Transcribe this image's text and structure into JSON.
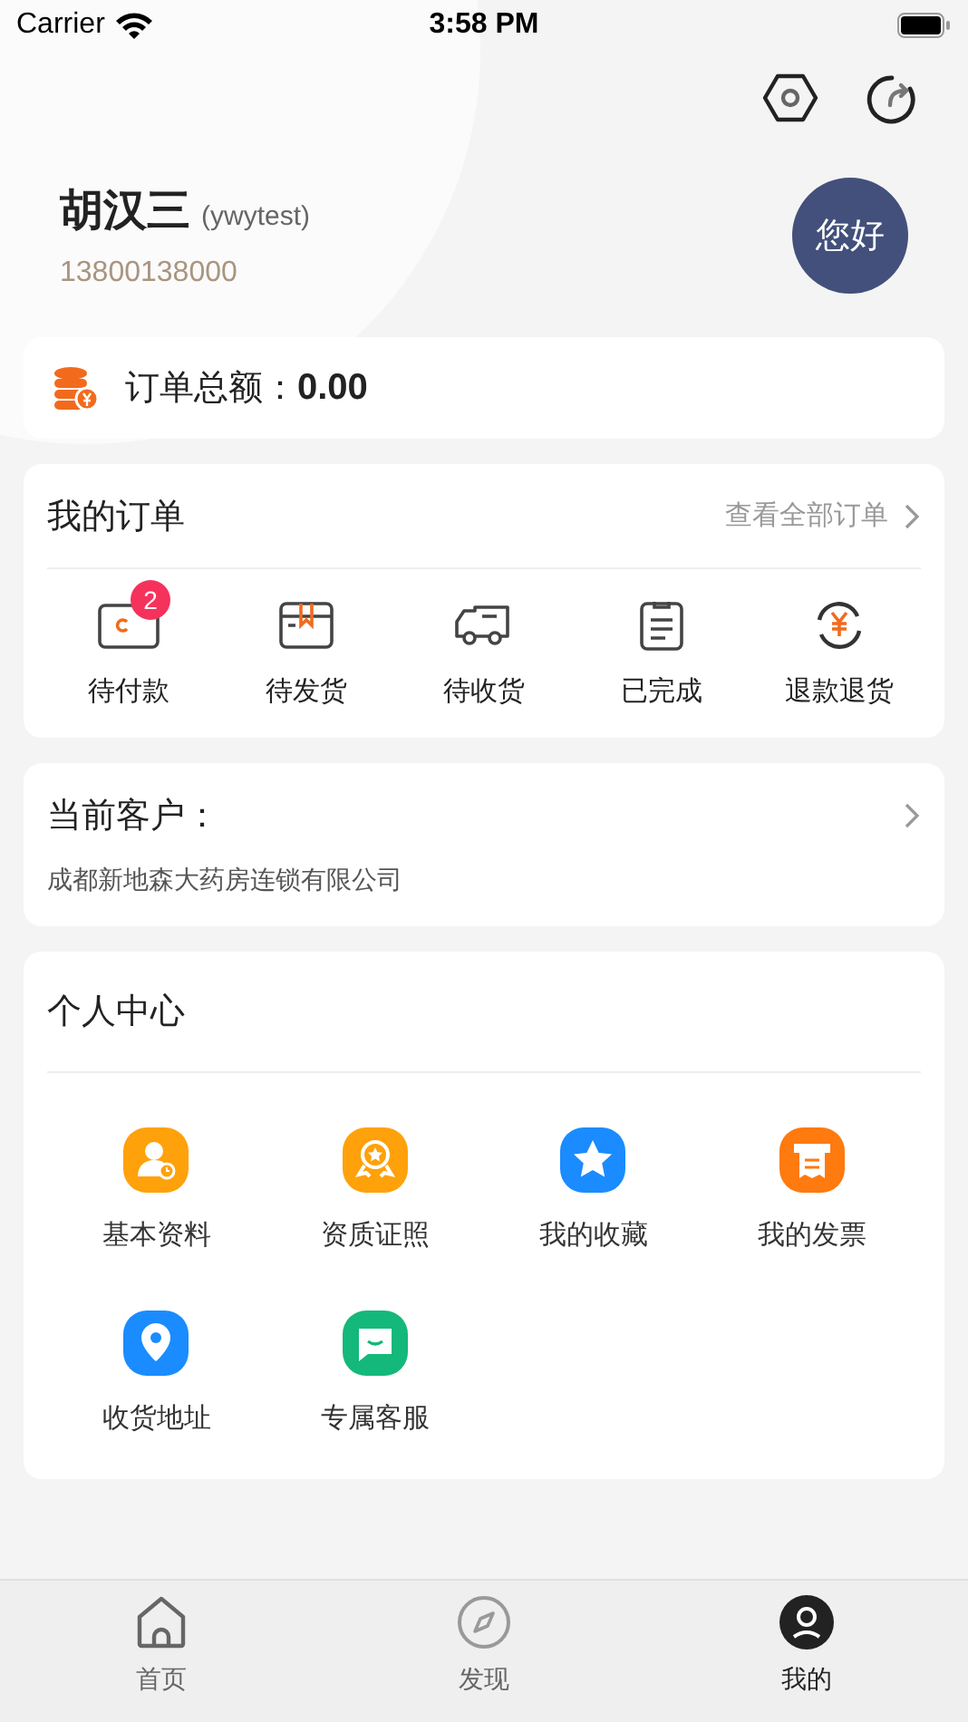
{
  "status_bar": {
    "carrier": "Carrier",
    "time": "3:58 PM"
  },
  "profile": {
    "name": "胡汉三",
    "account": "(ywytest)",
    "phone": "13800138000",
    "avatar_text": "您好"
  },
  "order_total": {
    "label": "订单总额：",
    "value": "0.00"
  },
  "orders": {
    "title": "我的订单",
    "link": "查看全部订单",
    "items": [
      {
        "kind": "wallet",
        "label": "待付款",
        "badge": "2"
      },
      {
        "kind": "box",
        "label": "待发货"
      },
      {
        "kind": "truck",
        "label": "待收货"
      },
      {
        "kind": "clipboard",
        "label": "已完成"
      },
      {
        "kind": "refund",
        "label": "退款退货"
      }
    ]
  },
  "customer": {
    "title": "当前客户：",
    "name": "成都新地森大药房连锁有限公司"
  },
  "personal_center": {
    "title": "个人中心",
    "items": [
      {
        "kind": "person",
        "label": "基本资料",
        "color": "#ffa10a"
      },
      {
        "kind": "medal",
        "label": "资质证照",
        "color": "#ffa10a"
      },
      {
        "kind": "star",
        "label": "我的收藏",
        "color": "#1a8cff"
      },
      {
        "kind": "invoice",
        "label": "我的发票",
        "color": "#ff7a0f"
      },
      {
        "kind": "pin",
        "label": "收货地址",
        "color": "#1a8cff"
      },
      {
        "kind": "chat",
        "label": "专属客服",
        "color": "#14b87a"
      }
    ]
  },
  "tab_bar": [
    {
      "kind": "home",
      "label": "首页",
      "selected": false
    },
    {
      "kind": "compass",
      "label": "发现",
      "selected": false
    },
    {
      "kind": "user",
      "label": "我的",
      "selected": true
    }
  ]
}
